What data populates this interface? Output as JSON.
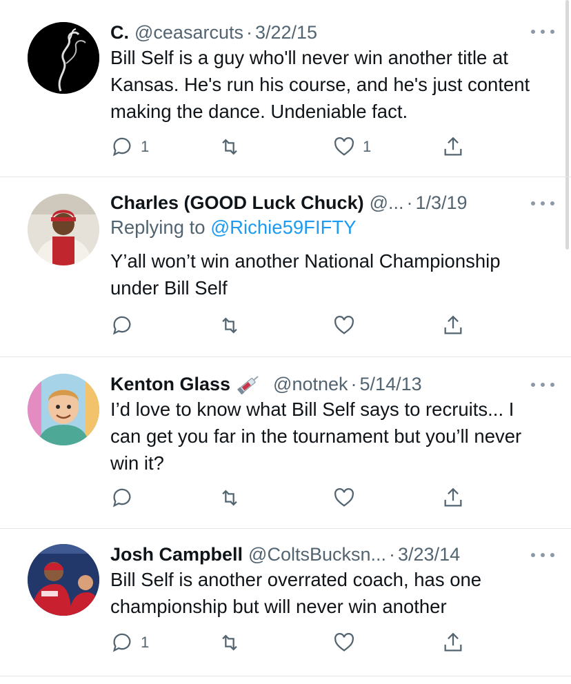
{
  "tweets": [
    {
      "name": "C.",
      "handle": "@ceasarcuts",
      "date": "3/22/15",
      "text": "Bill Self is a guy who'll never win another title at Kansas. He's run his course, and he's just content making the dance. Undeniable fact.",
      "reply_count": "1",
      "like_count": "1",
      "avatar": "smoke-avatar"
    },
    {
      "name": "Charles (GOOD Luck Chuck)",
      "handle": "@...",
      "date": "1/3/19",
      "replying_prefix": "Replying to ",
      "replying_to": "@Richie59FIFTY",
      "text": "Y’all won’t win another National Championship under Bill Self",
      "avatar": "person-red-hat-avatar"
    },
    {
      "name": "Kenton Glass",
      "handle": "@notnek",
      "date": "5/14/13",
      "name_emoji": "syringe-emoji",
      "text": "I’d love to know what Bill Self says to recruits... I can get you far in the tournament but you’ll never win it?",
      "avatar": "cartoon-avatar"
    },
    {
      "name": "Josh Campbell",
      "handle": "@ColtsBucksn...",
      "date": "3/23/14",
      "text": "Bill Self is another overrated coach, has one championship but will never win another",
      "reply_count": "1",
      "avatar": "reds-players-avatar"
    }
  ],
  "separator": "·",
  "colors": {
    "text": "#0f1419",
    "secondary": "#536471",
    "link": "#1d9bf0",
    "divider": "#e1e6ea"
  },
  "icons": [
    "reply-icon",
    "retweet-icon",
    "like-icon",
    "share-icon",
    "more-icon"
  ]
}
